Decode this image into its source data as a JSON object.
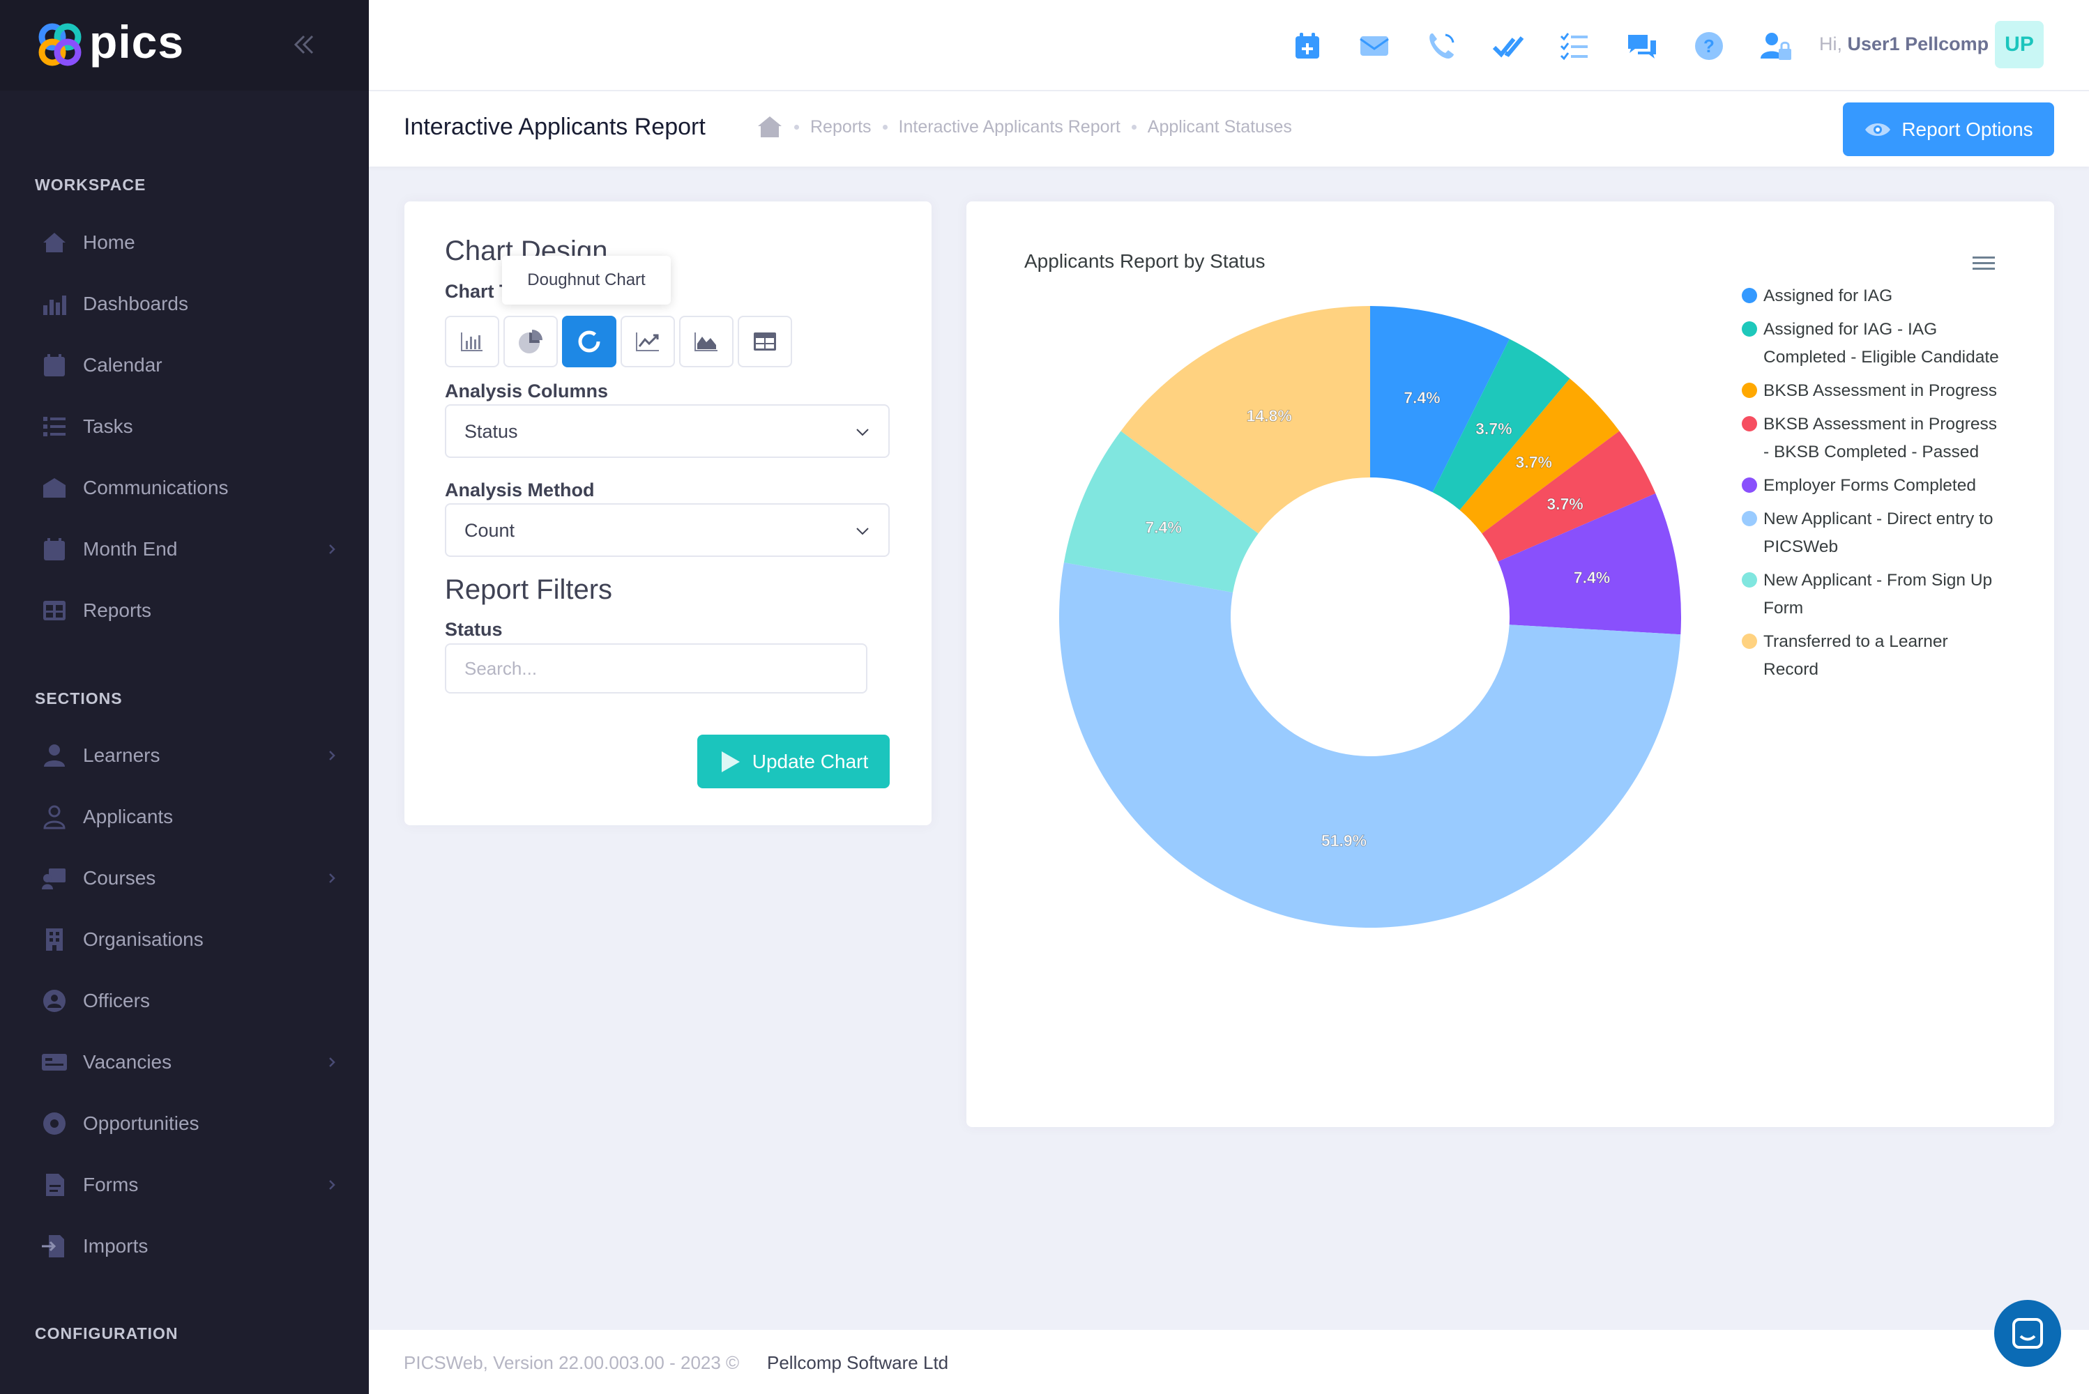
{
  "app": {
    "logo_text": "pics"
  },
  "sidebar": {
    "sections": [
      {
        "title": "WORKSPACE",
        "items": [
          {
            "label": "Home",
            "icon": "home-icon"
          },
          {
            "label": "Dashboards",
            "icon": "dashboard-icon"
          },
          {
            "label": "Calendar",
            "icon": "calendar-icon"
          },
          {
            "label": "Tasks",
            "icon": "tasks-icon"
          },
          {
            "label": "Communications",
            "icon": "communications-icon"
          },
          {
            "label": "Month End",
            "icon": "month-end-icon",
            "has_submenu": true
          },
          {
            "label": "Reports",
            "icon": "reports-icon"
          }
        ]
      },
      {
        "title": "SECTIONS",
        "items": [
          {
            "label": "Learners",
            "icon": "learners-icon",
            "has_submenu": true
          },
          {
            "label": "Applicants",
            "icon": "applicants-icon"
          },
          {
            "label": "Courses",
            "icon": "courses-icon",
            "has_submenu": true
          },
          {
            "label": "Organisations",
            "icon": "organisations-icon"
          },
          {
            "label": "Officers",
            "icon": "officers-icon"
          },
          {
            "label": "Vacancies",
            "icon": "vacancies-icon",
            "has_submenu": true
          },
          {
            "label": "Opportunities",
            "icon": "opportunities-icon"
          },
          {
            "label": "Forms",
            "icon": "forms-icon",
            "has_submenu": true
          },
          {
            "label": "Imports",
            "icon": "imports-icon"
          }
        ]
      },
      {
        "title": "CONFIGURATION",
        "items": []
      }
    ]
  },
  "header": {
    "icons": [
      "calendar-add-icon",
      "mail-icon",
      "phone-icon",
      "double-check-icon",
      "checklist-icon",
      "chat-icon",
      "help-icon",
      "user-lock-icon"
    ],
    "greeting": "Hi,",
    "user_name": "User1 Pellcomp",
    "avatar_initials": "UP"
  },
  "subheader": {
    "page_title": "Interactive Applicants Report",
    "breadcrumbs": [
      "Reports",
      "Interactive Applicants Report",
      "Applicant Statuses"
    ],
    "report_options_label": "Report Options"
  },
  "chart_design": {
    "title": "Chart Design",
    "chart_type_label": "Chart Type",
    "tooltip": "Doughnut Chart",
    "chart_types": [
      "bar-chart-icon",
      "pie-chart-icon",
      "doughnut-chart-icon",
      "line-chart-icon",
      "area-chart-icon",
      "table-chart-icon"
    ],
    "active_type": "doughnut-chart-icon",
    "analysis_columns_label": "Analysis Columns",
    "analysis_columns_value": "Status",
    "analysis_method_label": "Analysis Method",
    "analysis_method_value": "Count",
    "report_filters_title": "Report Filters",
    "status_label": "Status",
    "status_placeholder": "Search...",
    "update_button": "Update Chart"
  },
  "chart_data": {
    "type": "doughnut",
    "title": "Applicants Report by Status",
    "legend_position": "right",
    "series": [
      {
        "name": "Assigned for IAG",
        "value": 7.4,
        "label": "7.4%",
        "color": "#3399ff"
      },
      {
        "name": "Assigned for IAG - IAG Completed - Eligible Candidate",
        "value": 3.7,
        "label": "3.7%",
        "color": "#1ec8bb"
      },
      {
        "name": "BKSB Assessment in Progress",
        "value": 3.7,
        "label": "3.7%",
        "color": "#ffa800"
      },
      {
        "name": "BKSB Assessment in Progress - BKSB Completed - Passed",
        "value": 3.7,
        "label": "3.7%",
        "color": "#f64e60"
      },
      {
        "name": "Employer Forms Completed",
        "value": 7.4,
        "label": "7.4%",
        "color": "#8950fc"
      },
      {
        "name": "New Applicant - Direct entry to PICSWeb",
        "value": 51.9,
        "label": "51.9%",
        "color": "#99cbff"
      },
      {
        "name": "New Applicant - From Sign Up Form",
        "value": 7.4,
        "label": "7.4%",
        "color": "#80e6df"
      },
      {
        "name": "Transferred to a Learner Record",
        "value": 14.8,
        "label": "14.8%",
        "color": "#ffd280"
      }
    ]
  },
  "footer": {
    "version": "PICSWeb, Version 22.00.003.00 - 2023 ©",
    "company": "Pellcomp Software Ltd"
  }
}
